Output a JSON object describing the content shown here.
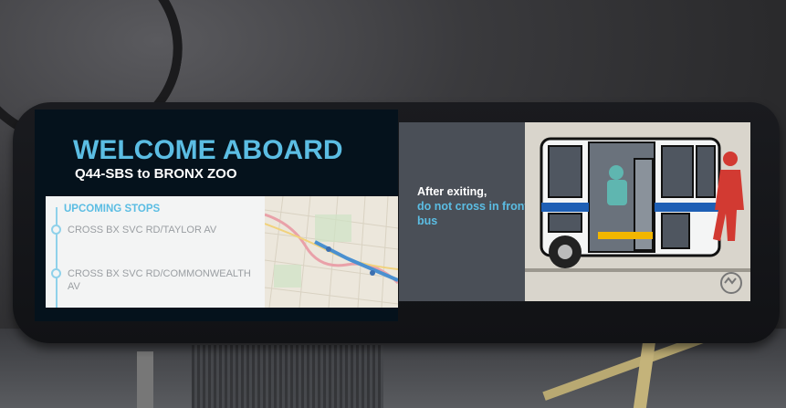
{
  "display": {
    "welcome": "WELCOME ABOARD",
    "route": "Q44-SBS to BRONX ZOO",
    "upcoming_heading": "UPCOMING STOPS",
    "stops": [
      "CROSS BX SVC RD/TAYLOR AV",
      "CROSS BX SVC RD/COMMONWEALTH AV"
    ],
    "safety_line1": "After exiting,",
    "safety_line2": "do not cross in front of the bus"
  },
  "icons": [
    "bus-icon",
    "pedestrian-icon",
    "mta-logo"
  ],
  "colors": {
    "accent_blue": "#5bbde3",
    "screen_dark": "#05121c",
    "panel_gray": "#4a4f57",
    "pedestrian_red": "#d23a32"
  }
}
